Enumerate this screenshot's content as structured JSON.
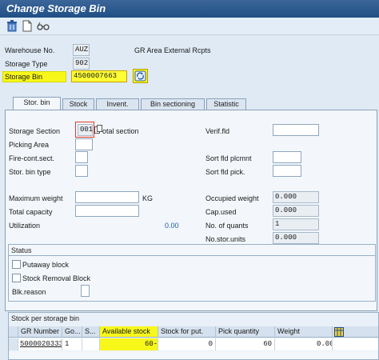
{
  "window": {
    "title": "Change Storage Bin"
  },
  "toolbar": {
    "icons": [
      "trash-icon",
      "new-document-icon",
      "glasses-icon"
    ]
  },
  "header": {
    "warehouse_label": "Warehouse No.",
    "warehouse_value": "AUZ",
    "warehouse_desc": "GR Area External Rcpts",
    "storage_type_label": "Storage Type",
    "storage_type_value": "902",
    "storage_bin_label": "Storage Bin",
    "storage_bin_value": "4500007663"
  },
  "tabs": [
    {
      "label": "Stor. bin",
      "active": true
    },
    {
      "label": "Stock"
    },
    {
      "label": "Invent."
    },
    {
      "label": "Bin sectioning"
    },
    {
      "label": "Statistic"
    }
  ],
  "form": {
    "storage_section_label": "Storage Section",
    "storage_section_value": "001",
    "storage_section_desc": "otal section",
    "picking_area_label": "Picking Area",
    "fire_label": "Fire-cont.sect.",
    "bin_type_label": "Stor. bin type",
    "max_weight_label": "Maximum weight",
    "max_weight_unit": "KG",
    "total_capacity_label": "Total capacity",
    "utilization_label": "Utilization",
    "utilization_value": "0.00",
    "verif_label": "Verif.fld",
    "sort_putaway_label": "Sort fld plcmnt",
    "sort_pick_label": "Sort fld pick.",
    "occupied_weight_label": "Occupied weight",
    "occupied_weight_value": "0.000",
    "cap_used_label": "Cap.used",
    "cap_used_value": "0.000",
    "quants_label": "No. of quants",
    "quants_value": "1",
    "stor_units_label": "No.stor.units",
    "stor_units_value": "0.000"
  },
  "status": {
    "title": "Status",
    "putaway_block": "Putaway block",
    "removal_block": "Stock Removal Block",
    "blk_reason_label": "Blk.reason"
  },
  "stock_table": {
    "title": "Stock per storage bin",
    "columns": [
      "GR Number",
      "Go...",
      "S...",
      "Available stock",
      "Stock for put.",
      "Pick quantity",
      "Weight"
    ],
    "rows": [
      [
        "5000020333",
        "1",
        "",
        "60-",
        "0",
        "60",
        "0.00"
      ]
    ]
  },
  "colors": {
    "title_bar": "#1f4f86",
    "highlight": "#f7f71a",
    "panel": "#f3f7fb"
  }
}
